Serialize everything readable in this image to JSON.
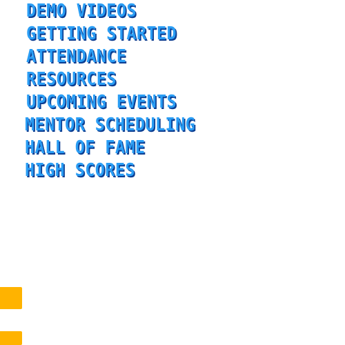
{
  "menu": {
    "items": [
      {
        "label": "DEMO VIDEOS"
      },
      {
        "label": "GETTING STARTED"
      },
      {
        "label": "ATTENDANCE"
      },
      {
        "label": "RESOURCES"
      },
      {
        "label": "UPCOMING EVENTS"
      },
      {
        "label": "MENTOR SCHEDULING"
      },
      {
        "label": "HALL OF FAME"
      },
      {
        "label": "HIGH SCORES"
      }
    ]
  },
  "colors": {
    "menu_text": "#2a9df4",
    "menu_shadow": "#0b3d91",
    "accent_block": "#ffb300",
    "background": "#ffffff"
  }
}
